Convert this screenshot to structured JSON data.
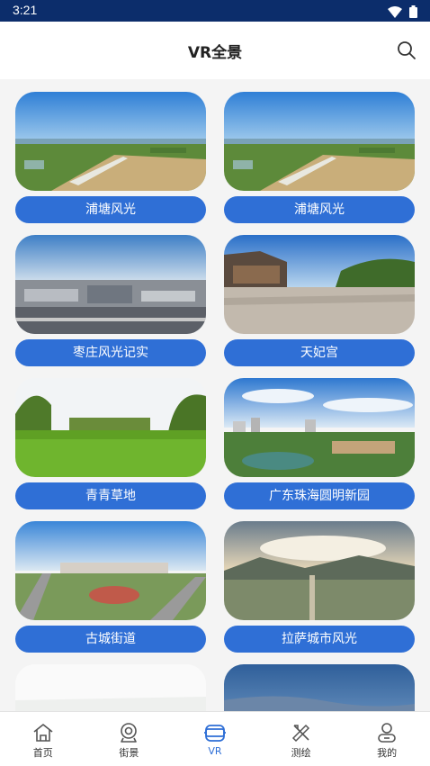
{
  "status_bar": {
    "time": "3:21",
    "icons": [
      "wifi-icon",
      "battery-icon"
    ]
  },
  "header": {
    "title": "VR全景",
    "search_icon": "search-icon"
  },
  "cards": [
    {
      "label": "浦塘风光"
    },
    {
      "label": "浦塘风光"
    },
    {
      "label": "枣庄风光记实"
    },
    {
      "label": "天妃宫"
    },
    {
      "label": "青青草地"
    },
    {
      "label": "广东珠海圆明新园"
    },
    {
      "label": "古城街道"
    },
    {
      "label": "拉萨城市风光"
    }
  ],
  "tabs": [
    {
      "label": "首页",
      "icon": "home-icon",
      "active": false
    },
    {
      "label": "街景",
      "icon": "street-view-icon",
      "active": false
    },
    {
      "label": "VR",
      "icon": "vr-headset-icon",
      "active": true
    },
    {
      "label": "测绘",
      "icon": "survey-tools-icon",
      "active": false
    },
    {
      "label": "我的",
      "icon": "profile-icon",
      "active": false
    }
  ],
  "colors": {
    "status_bar": "#0c2d6b",
    "accent": "#2f6fd6",
    "text": "#222222"
  }
}
